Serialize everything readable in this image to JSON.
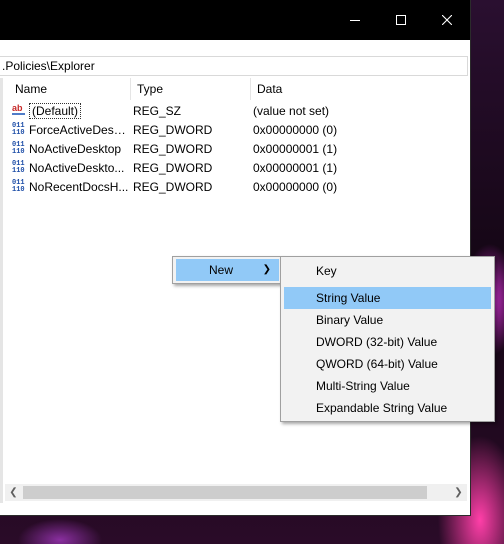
{
  "address": {
    "path": ".Policies\\Explorer"
  },
  "columns": {
    "name": "Name",
    "type": "Type",
    "data": "Data"
  },
  "rows": [
    {
      "icon": "string-value-icon",
      "name": "(Default)",
      "type": "REG_SZ",
      "data": "(value not set)"
    },
    {
      "icon": "binary-value-icon",
      "name": "ForceActiveDesk...",
      "type": "REG_DWORD",
      "data": "0x00000000 (0)"
    },
    {
      "icon": "binary-value-icon",
      "name": "NoActiveDesktop",
      "type": "REG_DWORD",
      "data": "0x00000001 (1)"
    },
    {
      "icon": "binary-value-icon",
      "name": "NoActiveDeskto...",
      "type": "REG_DWORD",
      "data": "0x00000001 (1)"
    },
    {
      "icon": "binary-value-icon",
      "name": "NoRecentDocsH...",
      "type": "REG_DWORD",
      "data": "0x00000000 (0)"
    }
  ],
  "context_menu": {
    "new_label": "New"
  },
  "submenu": {
    "items": [
      "Key",
      "String Value",
      "Binary Value",
      "DWORD (32-bit) Value",
      "QWORD (64-bit) Value",
      "Multi-String Value",
      "Expandable String Value"
    ],
    "highlighted": "String Value"
  },
  "colors": {
    "highlight": "#91c9f7",
    "titlebar": "#000000"
  }
}
